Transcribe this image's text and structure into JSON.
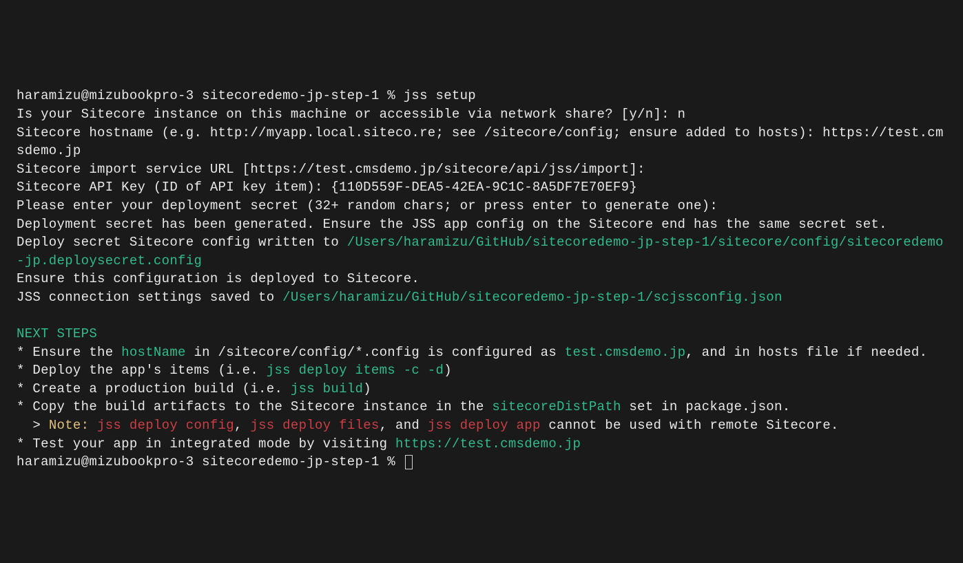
{
  "prompt1": "haramizu@mizubookpro-3 sitecoredemo-jp-step-1 % jss setup",
  "l1": "Is your Sitecore instance on this machine or accessible via network share? [y/n]: n",
  "l2": "Sitecore hostname (e.g. http://myapp.local.siteco.re; see /sitecore/config; ensure added to hosts): https://test.cmsdemo.jp",
  "l3": "Sitecore import service URL [https://test.cmsdemo.jp/sitecore/api/jss/import]: ",
  "l4": "Sitecore API Key (ID of API key item): {110D559F-DEA5-42EA-9C1C-8A5DF7E70EF9}",
  "l5": "Please enter your deployment secret (32+ random chars; or press enter to generate one): ",
  "l6": "Deployment secret has been generated. Ensure the JSS app config on the Sitecore end has the same secret set.",
  "l7a": "Deploy secret Sitecore config written to ",
  "l7b": "/Users/haramizu/GitHub/sitecoredemo-jp-step-1/sitecore/config/sitecoredemo-jp.deploysecret.config",
  "l8": "Ensure this configuration is deployed to Sitecore.",
  "l9a": "JSS connection settings saved to ",
  "l9b": "/Users/haramizu/GitHub/sitecoredemo-jp-step-1/scjssconfig.json",
  "heading": "NEXT STEPS",
  "s1a": "* Ensure the ",
  "s1b": "hostName",
  "s1c": " in /sitecore/config/*.config is configured as ",
  "s1d": "test.cmsdemo.jp",
  "s1e": ", and in hosts file if needed.",
  "s2a": "* Deploy the app's items (i.e. ",
  "s2b": "jss deploy items -c -d",
  "s2c": ")",
  "s3a": "* Create a production build (i.e. ",
  "s3b": "jss build",
  "s3c": ")",
  "s4a": "* Copy the build artifacts to the Sitecore instance in the ",
  "s4b": "sitecoreDistPath",
  "s4c": " set in package.json.",
  "n1a": "  > ",
  "n1b": "Note:",
  "n1c": " ",
  "n1d": "jss deploy config",
  "n1e": ", ",
  "n1f": "jss deploy files",
  "n1g": ", and ",
  "n1h": "jss deploy app",
  "n1i": " cannot be used with remote Sitecore.",
  "s5a": "* Test your app in integrated mode by visiting ",
  "s5b": "https://test.cmsdemo.jp",
  "prompt2": "haramizu@mizubookpro-3 sitecoredemo-jp-step-1 % "
}
